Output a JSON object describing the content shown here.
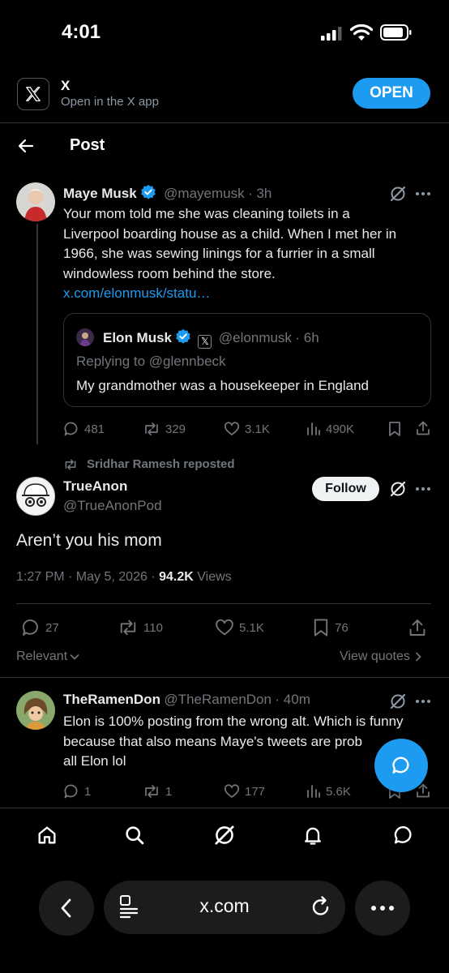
{
  "status_bar": {
    "time": "4:01"
  },
  "app_banner": {
    "app_name": "X",
    "subtitle": "Open in the X app",
    "open_label": "OPEN"
  },
  "header": {
    "title": "Post"
  },
  "parent_post": {
    "name": "Maye Musk",
    "handle": "@mayemusk",
    "time": "· 3h",
    "text_lines": [
      "Your mom told me she was cleaning toilets in a",
      "Liverpool boarding house as a child. When I met her in",
      "1966, she was sewing linings for a furrier in a small",
      "windowless room behind the store."
    ],
    "link": "x.com/elonmusk/statu…",
    "quote": {
      "name": "Elon Musk",
      "handle": "@elonmusk",
      "time": "· 6h",
      "replying_to": "Replying to @glennbeck",
      "text": "My grandmother was a housekeeper in England"
    },
    "stats": {
      "replies": "481",
      "reposts": "329",
      "likes": "3.1K",
      "views": "490K"
    }
  },
  "main_post": {
    "repost_label": "Sridhar Ramesh reposted",
    "name": "TrueAnon",
    "handle": "@TrueAnonPod",
    "follow_label": "Follow",
    "text": "Aren’t you his mom",
    "timestamp": "1:27 PM · May 5, 2026 ·",
    "views_count": "94.2K",
    "views_label": "Views",
    "stats": {
      "replies": "27",
      "reposts": "110",
      "likes": "5.1K",
      "bookmarks": "76"
    }
  },
  "sort": {
    "relevant_label": "Relevant",
    "view_quotes_label": "View quotes"
  },
  "reply": {
    "name": "TheRamenDon",
    "handle": "@TheRamenDon",
    "time": "· 40m",
    "text_lines": [
      "Elon is 100% posting from the wrong alt. Which is funny",
      "because that also means Maye's tweets are prob",
      "all Elon lol"
    ],
    "stats": {
      "replies": "1",
      "reposts": "1",
      "likes": "177",
      "views": "5.6K"
    }
  },
  "browser": {
    "url": "x.com"
  },
  "colors": {
    "accent": "#1d9bf0",
    "background": "#000000",
    "muted": "#71767b",
    "text": "#e7e9ea"
  }
}
